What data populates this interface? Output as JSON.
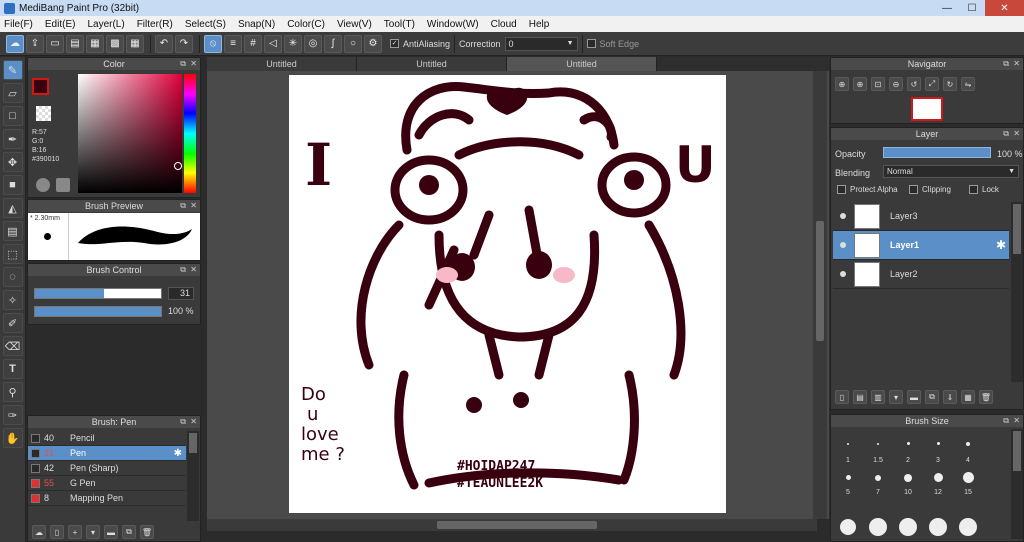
{
  "window": {
    "title": "MediBang Paint Pro (32bit)",
    "minimize": "—",
    "maximize": "☐",
    "close": "✕"
  },
  "menu": [
    "File(F)",
    "Edit(E)",
    "Layer(L)",
    "Filter(R)",
    "Select(S)",
    "Snap(N)",
    "Color(C)",
    "View(V)",
    "Tool(T)",
    "Window(W)",
    "Cloud",
    "Help"
  ],
  "toolbar": {
    "antialiasing_label": "AntiAliasing",
    "correction_label": "Correction",
    "correction_value": "0",
    "softedge_label": "Soft Edge",
    "antialiasing_checked": "✓"
  },
  "tabs": [
    "Untitled",
    "Untitled",
    "Untitled"
  ],
  "color_panel": {
    "title": "Color",
    "r": "R:57",
    "g": "G:0",
    "b": "B:16",
    "hex": "#390010",
    "fg": "#390010"
  },
  "brush_preview": {
    "title": "Brush Preview",
    "size": "2.30mm"
  },
  "brush_control": {
    "title": "Brush Control",
    "size_value": "31",
    "opacity_value": "100 %",
    "size_fraction": 0.55,
    "opacity_fraction": 1.0
  },
  "brush_list": {
    "title": "Brush: Pen",
    "items": [
      {
        "num": "40",
        "name": "Pencil",
        "color": "#2a2a2a"
      },
      {
        "num": "31",
        "name": "Pen",
        "color": "#2a2a2a",
        "selected": true
      },
      {
        "num": "42",
        "name": "Pen (Sharp)",
        "color": "#2a2a2a"
      },
      {
        "num": "55",
        "name": "G Pen",
        "color": "#e03030"
      },
      {
        "num": "8",
        "name": "Mapping Pen",
        "color": "#e03030"
      }
    ]
  },
  "navigator": {
    "title": "Navigator"
  },
  "layer_panel": {
    "title": "Layer",
    "opacity_label": "Opacity",
    "opacity_value": "100 %",
    "blending_label": "Blending",
    "blending_value": "Normal",
    "protect_alpha": "Protect Alpha",
    "clipping": "Clipping",
    "lock": "Lock",
    "layers": [
      {
        "name": "Layer3"
      },
      {
        "name": "Layer1",
        "selected": true
      },
      {
        "name": "Layer2"
      }
    ]
  },
  "brush_size": {
    "title": "Brush Size",
    "labels": [
      "1",
      "1.5",
      "2",
      "3",
      "4",
      "5",
      "7",
      "10",
      "12",
      "15"
    ]
  },
  "artwork": {
    "text_i": "I",
    "text_u": "U",
    "text_do": "Do",
    "text_u2": "u",
    "text_love": "love",
    "text_me": "me ?",
    "tag1": "#HOIDAP247",
    "tag2": "#TEAUNLEE2K",
    "ink": "#390010"
  }
}
